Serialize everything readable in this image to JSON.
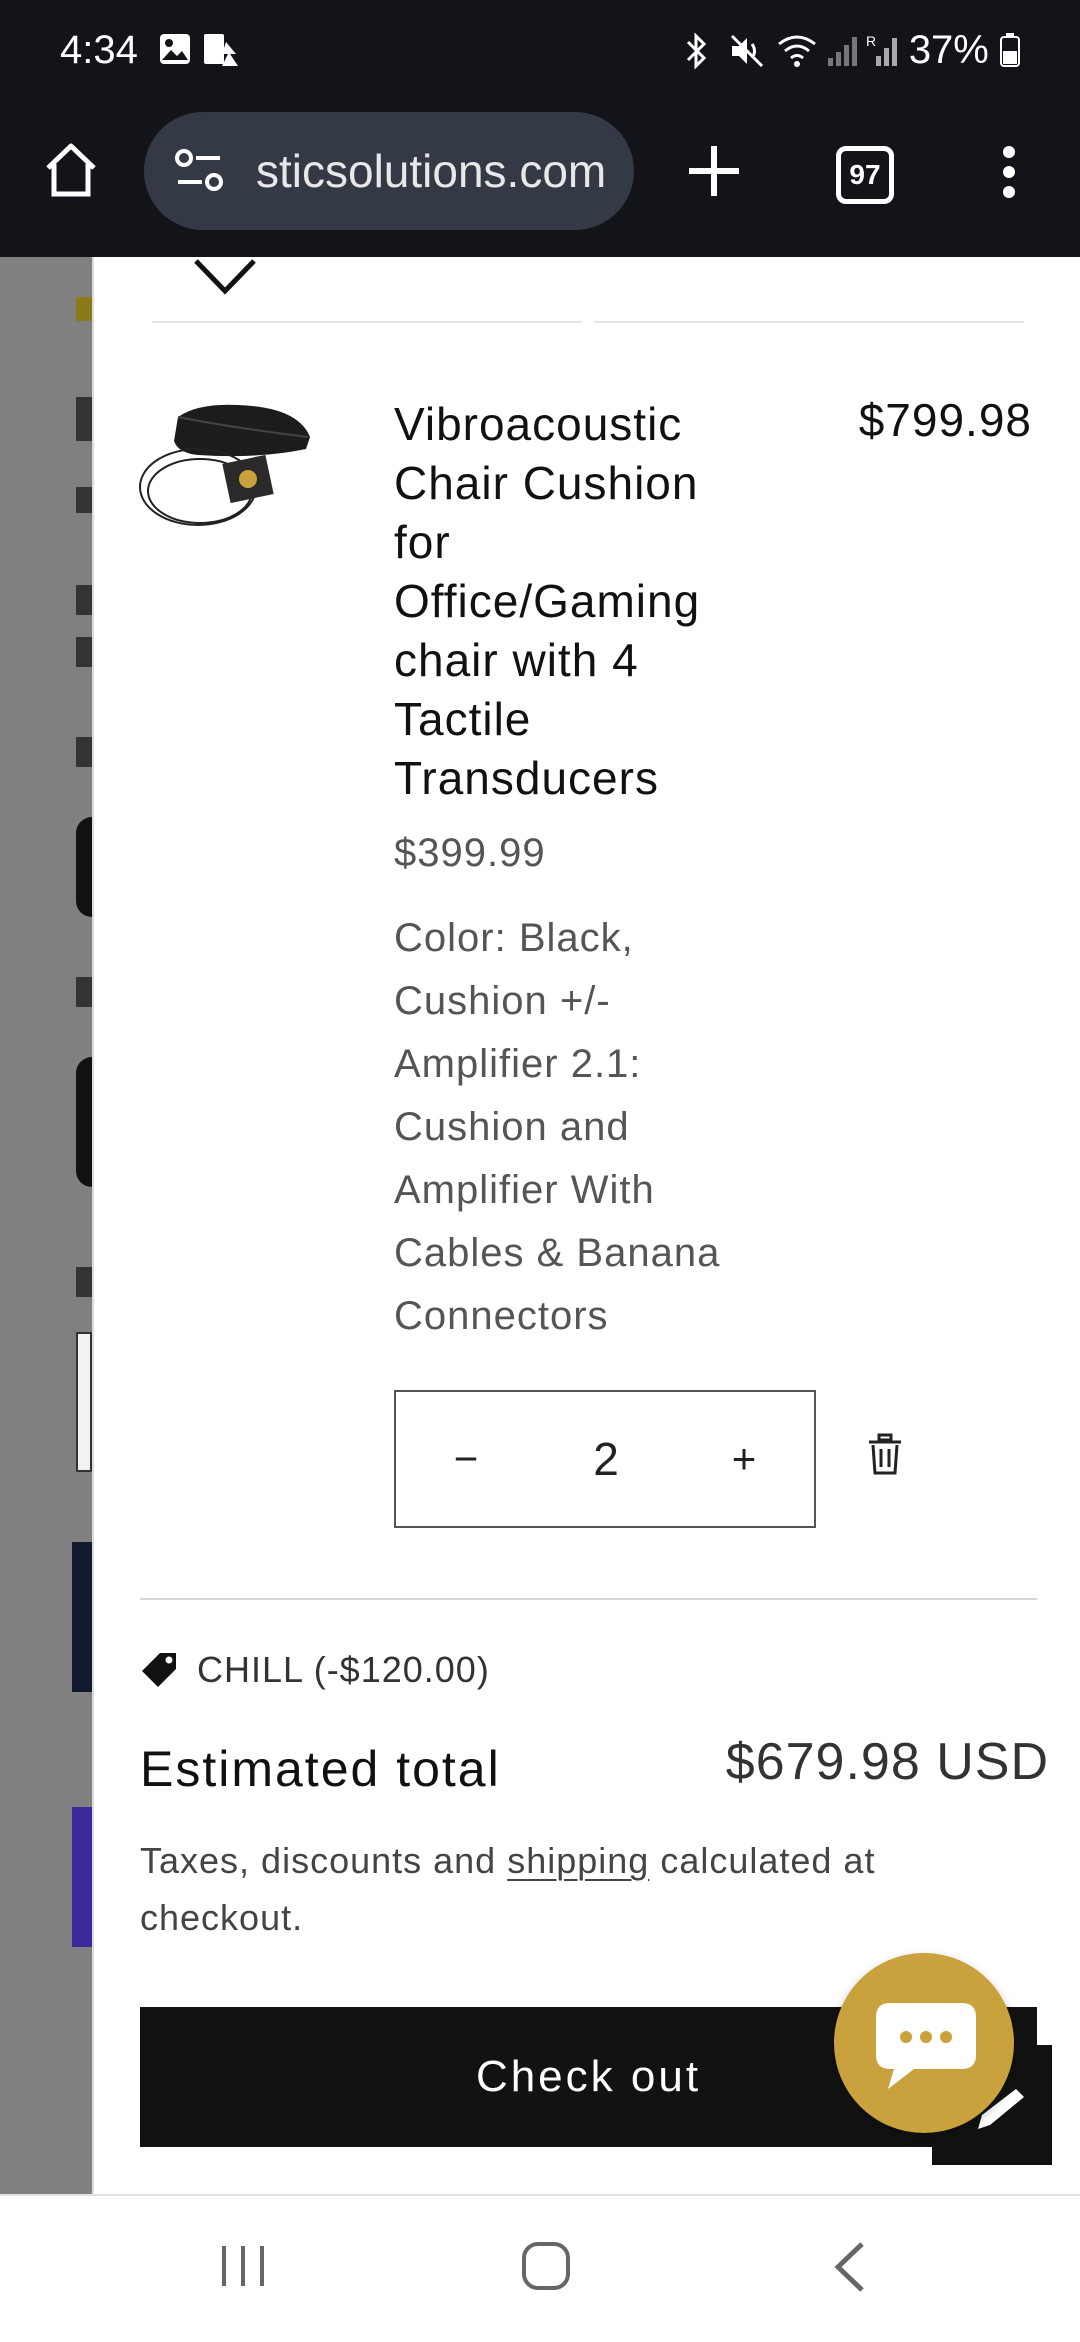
{
  "status_bar": {
    "time": "4:34",
    "battery": "37%"
  },
  "browser": {
    "url": "sticsolutions.com",
    "tab_count": "97"
  },
  "cart_item": {
    "title": "Vibroacoustic Chair Cushion for Office/Gaming chair with 4 Tactile Transducers",
    "unit_price": "$399.99",
    "line_price": "$799.98",
    "variant": "Color: Black, Cushion +/- Amplifier 2.1: Cushion and Amplifier With Cables & Banana Connectors",
    "quantity": "2",
    "quantity_minus": "−",
    "quantity_plus": "+"
  },
  "discount": {
    "label": "CHILL (-$120.00)"
  },
  "totals": {
    "label": "Estimated total",
    "value": "$679.98 USD"
  },
  "tax_note": {
    "before": "Taxes, discounts and ",
    "link": "shipping",
    "after": " calculated at checkout."
  },
  "checkout": {
    "label": "Check out"
  },
  "icons": [
    "home-icon",
    "site-settings-icon",
    "new-tab-icon",
    "tab-switcher-icon",
    "more-menu-icon",
    "chevron-down-icon",
    "trash-icon",
    "tag-icon",
    "chat-icon",
    "recent-apps-icon",
    "home-nav-icon",
    "back-icon"
  ],
  "colors": {
    "checkout_bg": "#121212",
    "chat_fab": "#c9a13d",
    "browser_bar": "#13141a",
    "omnibox": "#343a45"
  }
}
